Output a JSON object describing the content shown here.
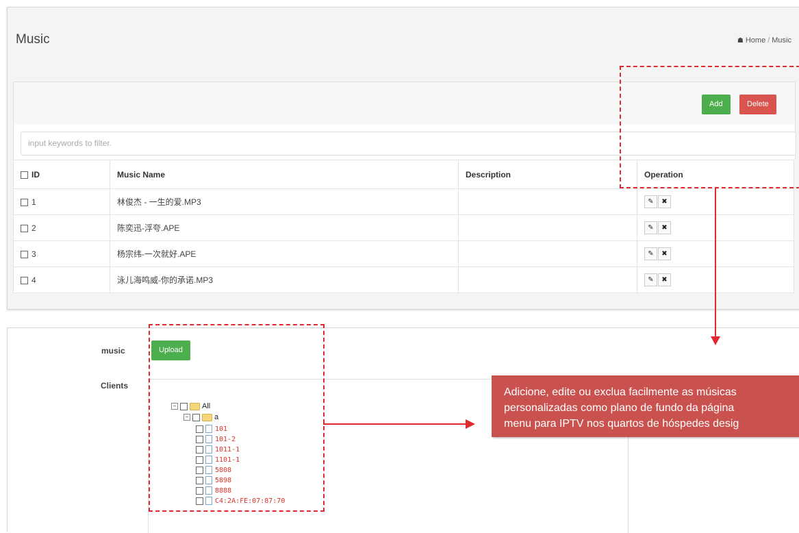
{
  "header": {
    "title": "Music",
    "breadcrumb": {
      "home": "Home",
      "separator": "/",
      "current": "Music"
    }
  },
  "toolbar": {
    "add_label": "Add",
    "delete_label": "Delete"
  },
  "filter": {
    "placeholder": "input keywords to filter."
  },
  "table": {
    "columns": [
      "ID",
      "Music Name",
      "Description",
      "Operation"
    ],
    "rows": [
      {
        "id": "1",
        "name": "林俊杰 - 一生的爱.MP3",
        "description": ""
      },
      {
        "id": "2",
        "name": "陈奕迅-浮夸.APE",
        "description": ""
      },
      {
        "id": "3",
        "name": "杨宗纬-一次就好.APE",
        "description": ""
      },
      {
        "id": "4",
        "name": "泳儿海鸣威-你的承诺.MP3",
        "description": ""
      }
    ],
    "edit_icon": "pencil-icon",
    "delete_icon": "times-icon"
  },
  "form": {
    "music_label": "music",
    "upload_label": "Upload",
    "clients_label": "Clients",
    "tree": {
      "root": "All",
      "group": "a",
      "leaves": [
        "101",
        "101-2",
        "1011-1",
        "1101-1",
        "5808",
        "5898",
        "8888",
        "C4:2A:FE:07:87:70"
      ]
    }
  },
  "callout": {
    "lines": [
      "Adicione, edite ou exclua facilmente as músicas",
      "personalizadas como plano de fundo da página",
      "menu para IPTV nos quartos de hóspedes desig"
    ]
  },
  "colors": {
    "add_button": "#4cae4c",
    "delete_button": "#d9534f",
    "annotation_red": "#e0282f",
    "callout_bg": "#c9524f",
    "leaf_text": "#d9322c"
  }
}
